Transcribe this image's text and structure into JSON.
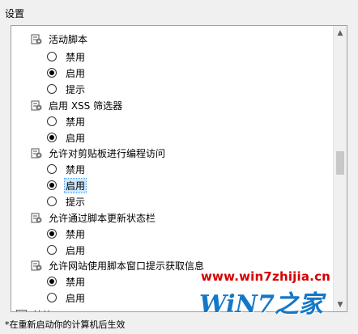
{
  "section": {
    "title": "设置"
  },
  "groups": [
    {
      "title": "活动脚本",
      "options": [
        {
          "label": "禁用",
          "checked": false
        },
        {
          "label": "启用",
          "checked": true
        },
        {
          "label": "提示",
          "checked": false
        }
      ]
    },
    {
      "title": "启用 XSS 筛选器",
      "options": [
        {
          "label": "禁用",
          "checked": false
        },
        {
          "label": "启用",
          "checked": true
        }
      ]
    },
    {
      "title": "允许对剪贴板进行编程访问",
      "options": [
        {
          "label": "禁用",
          "checked": false
        },
        {
          "label": "启用",
          "checked": true,
          "selected": true
        },
        {
          "label": "提示",
          "checked": false
        }
      ]
    },
    {
      "title": "允许通过脚本更新状态栏",
      "options": [
        {
          "label": "禁用",
          "checked": true
        },
        {
          "label": "启用",
          "checked": false
        }
      ]
    },
    {
      "title": "允许网站使用脚本窗口提示获取信息",
      "options": [
        {
          "label": "禁用",
          "checked": true
        },
        {
          "label": "启用",
          "checked": false
        }
      ]
    }
  ],
  "next_group": {
    "title": "其他"
  },
  "footnote": "*在重新启动你的计算机后生效",
  "watermark": {
    "url": "www.win7zhijia.cn",
    "logo": "WiN7之家"
  },
  "icons": {
    "setting": "gear-icon",
    "scroll_up": "arrow-up-icon",
    "scroll_down": "arrow-down-icon"
  },
  "colors": {
    "selected_bg": "#cce8ff",
    "watermark_red": "#d40000",
    "watermark_blue": "#1478c8"
  }
}
